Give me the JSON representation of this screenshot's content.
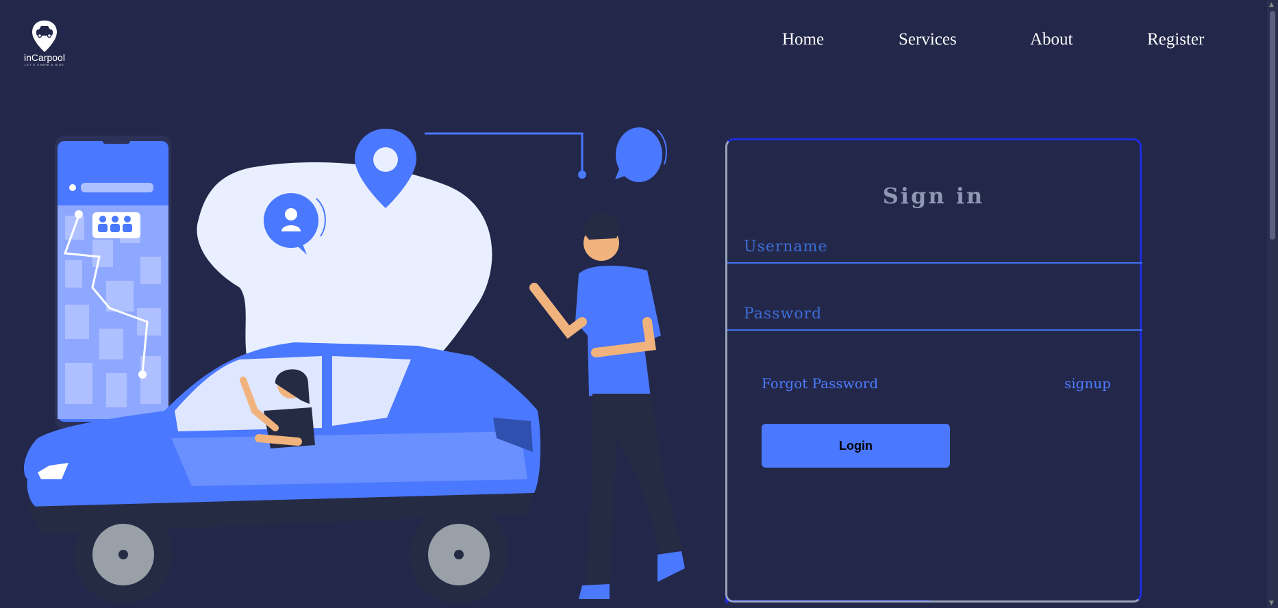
{
  "brand": {
    "name": "inCarpool",
    "tagline": "LET'S SHARE A RIDE"
  },
  "nav": {
    "items": [
      {
        "label": "Home"
      },
      {
        "label": "Services"
      },
      {
        "label": "About"
      },
      {
        "label": "Register"
      }
    ]
  },
  "signin": {
    "title": "Sign in",
    "username_placeholder": "Username",
    "password_placeholder": "Password",
    "forgot_label": "Forgot Password",
    "signup_label": "signup",
    "login_label": "Login"
  },
  "colors": {
    "background": "#23284a",
    "accent": "#4a78ff",
    "card_border": "#1d2be0"
  },
  "illustration": {
    "icons": [
      "location-pin-icon",
      "chat-bubble-icon",
      "user-avatar-icon",
      "phone-map-icon",
      "car-icon",
      "woman-driver-icon",
      "man-waving-icon"
    ]
  }
}
